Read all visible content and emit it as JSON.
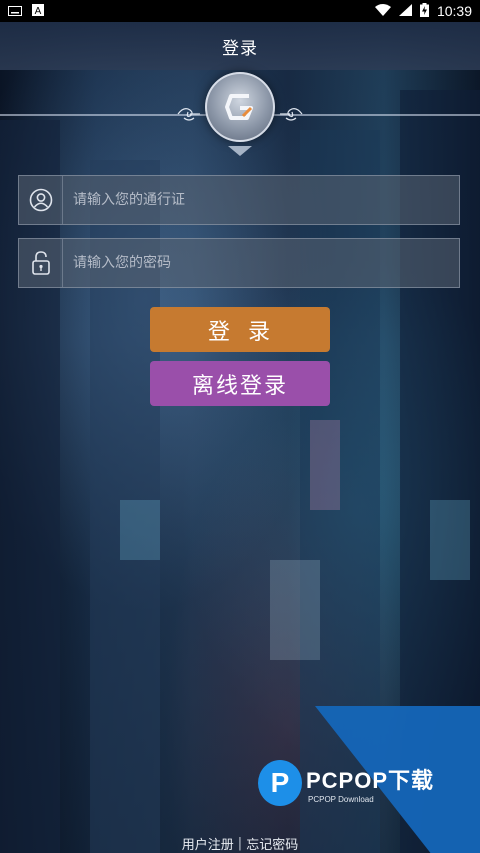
{
  "status_bar": {
    "time": "10:39",
    "icons": [
      "keyboard-icon",
      "a-icon",
      "wifi-icon",
      "signal-icon",
      "battery-charging-icon"
    ]
  },
  "header": {
    "title": "登录"
  },
  "logo": {
    "glyph": "G"
  },
  "form": {
    "account": {
      "placeholder": "请输入您的通行证",
      "value": "",
      "icon": "user-icon"
    },
    "password": {
      "placeholder": "请输入您的密码",
      "value": "",
      "icon": "lock-icon"
    },
    "login_label": "登录",
    "offline_label": "离线登录"
  },
  "footer": {
    "register_label": "用户注册",
    "separator": "|",
    "forgot_label": "忘记密码"
  },
  "watermark": {
    "mark": "P",
    "brand": "PCPOP下载",
    "tagline": "PCPOP Download"
  },
  "colors": {
    "login_button": "#c67a30",
    "offline_button": "#9a4faa",
    "watermark_blue": "#1566b8"
  }
}
